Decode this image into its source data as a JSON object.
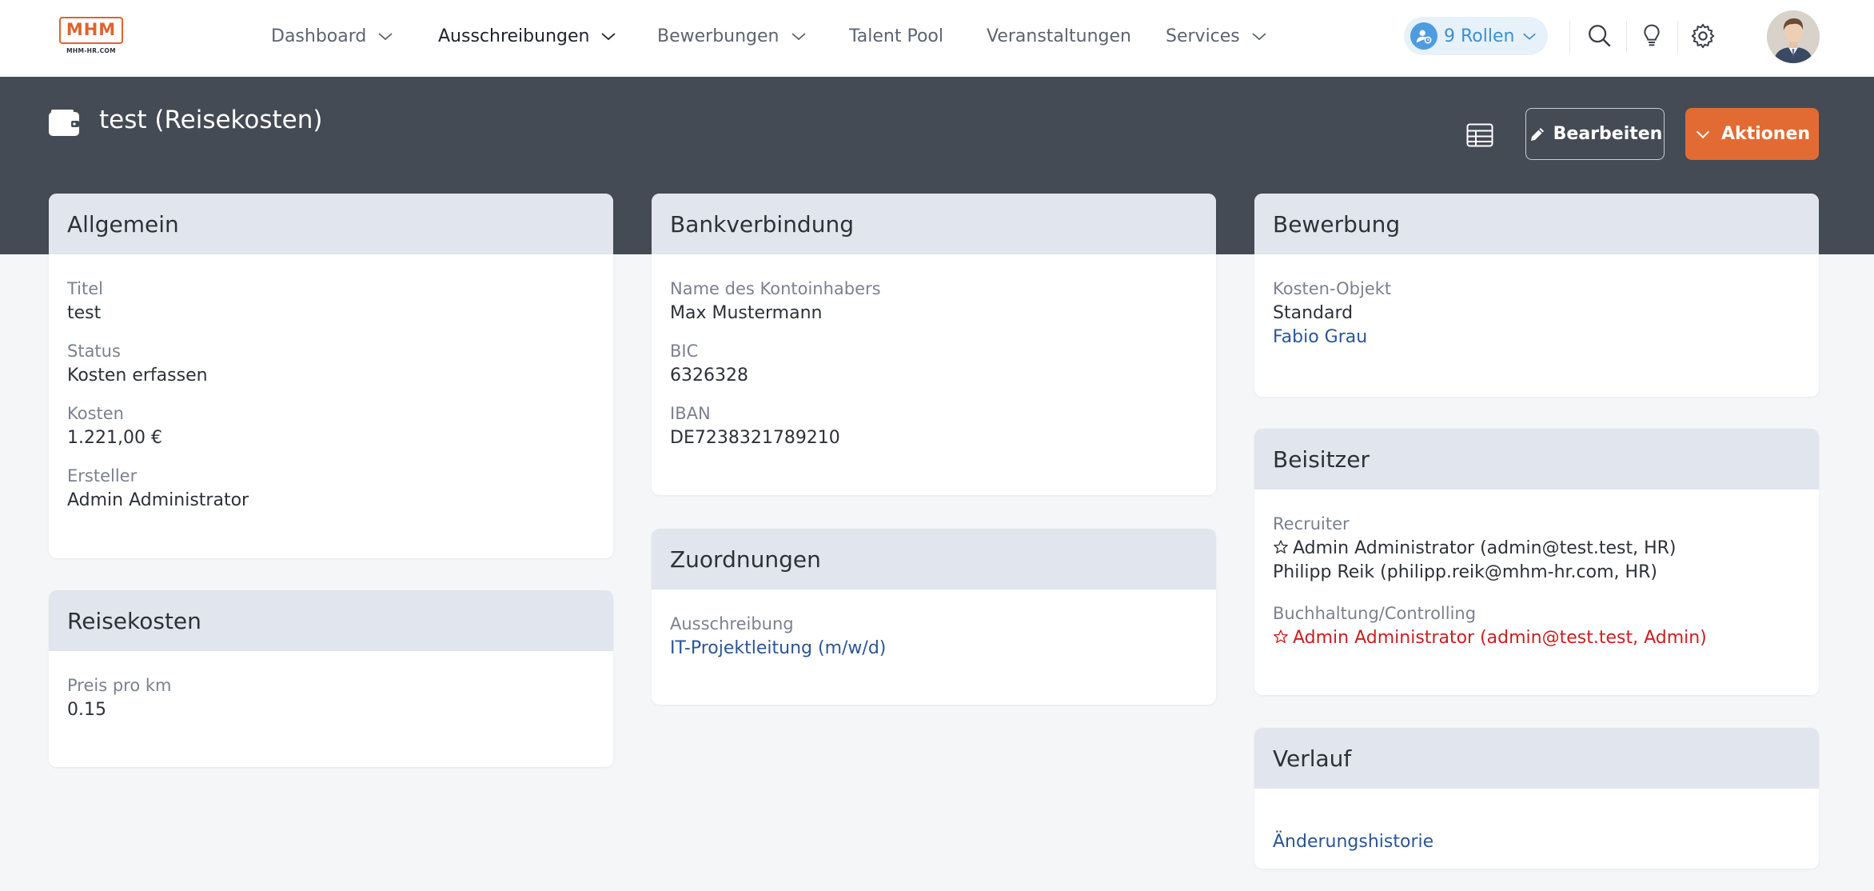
{
  "brand": {
    "logo_text": "MHM",
    "logo_subtext": "MHM-HR.COM",
    "accent": "#e26b33",
    "band_color": "#454b54"
  },
  "nav": {
    "items": [
      {
        "label": "Dashboard",
        "has_dropdown": true
      },
      {
        "label": "Ausschreibungen",
        "has_dropdown": true,
        "active": true
      },
      {
        "label": "Bewerbungen",
        "has_dropdown": true
      },
      {
        "label": "Talent Pool",
        "has_dropdown": false
      },
      {
        "label": "Veranstaltungen",
        "has_dropdown": false
      },
      {
        "label": "Services",
        "has_dropdown": true
      }
    ],
    "roles_label": "9 Rollen",
    "icons": [
      "search-icon",
      "lightbulb-icon",
      "gear-icon"
    ]
  },
  "header": {
    "icon": "wallet-icon",
    "title": "test (Reisekosten)",
    "table_icon": "table-icon",
    "edit_label": "Bearbeiten",
    "actions_label": "Aktionen"
  },
  "cards": {
    "allgemein": {
      "title": "Allgemein",
      "fields": [
        {
          "label": "Titel",
          "value": "test"
        },
        {
          "label": "Status",
          "value": "Kosten erfassen"
        },
        {
          "label": "Kosten",
          "value": "1.221,00 €"
        },
        {
          "label": "Ersteller",
          "value": "Admin Administrator"
        }
      ]
    },
    "reisekosten": {
      "title": "Reisekosten",
      "fields": [
        {
          "label": "Preis pro km",
          "value": "0.15"
        }
      ]
    },
    "bank": {
      "title": "Bankverbindung",
      "fields": [
        {
          "label": "Name des Kontoinhabers",
          "value": "Max Mustermann"
        },
        {
          "label": "BIC",
          "value": "6326328"
        },
        {
          "label": "IBAN",
          "value": "DE7238321789210"
        }
      ]
    },
    "zuordnungen": {
      "title": "Zuordnungen",
      "label": "Ausschreibung",
      "link": "IT-Projektleitung (m/w/d)"
    },
    "bewerbung": {
      "title": "Bewerbung",
      "label": "Kosten-Objekt",
      "value": "Standard",
      "link": "Fabio Grau"
    },
    "beisitzer": {
      "title": "Beisitzer",
      "recruiter_label": "Recruiter",
      "recruiter_1": "Admin Administrator (admin@test.test, HR)",
      "recruiter_2": "Philipp Reik (philipp.reik@mhm-hr.com, HR)",
      "buchhaltung_label": "Buchhaltung/Controlling",
      "buchhaltung_1": "Admin Administrator (admin@test.test, Admin)",
      "warning_color": "#cc1e1e"
    },
    "verlauf": {
      "title": "Verlauf",
      "link": "Änderungshistorie"
    }
  }
}
